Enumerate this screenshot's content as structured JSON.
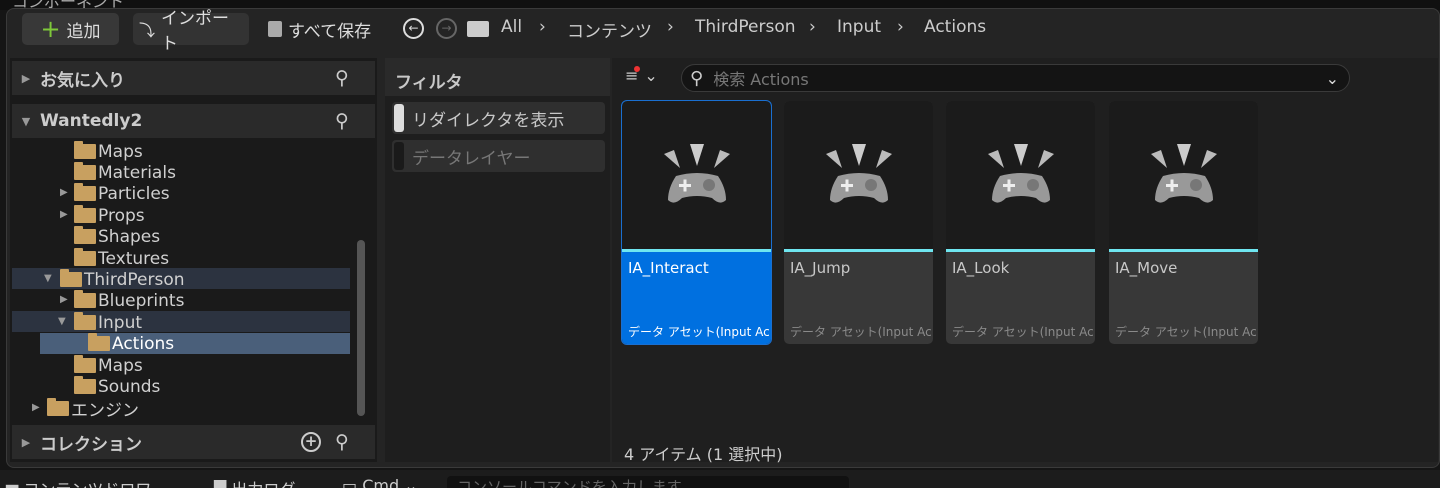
{
  "top_strip": "コンポーネント",
  "toolbar": {
    "add": "追加",
    "import": "インポート",
    "save_all": "すべて保存"
  },
  "breadcrumb": [
    "All",
    "コンテンツ",
    "ThirdPerson",
    "Input",
    "Actions"
  ],
  "sidebar": {
    "favorites": "お気に入り",
    "project": "Wantedly2",
    "tree": [
      {
        "label": "Maps"
      },
      {
        "label": "Materials"
      },
      {
        "label": "Particles"
      },
      {
        "label": "Props"
      },
      {
        "label": "Shapes"
      },
      {
        "label": "Textures"
      },
      {
        "label": "ThirdPerson"
      },
      {
        "label": "Blueprints"
      },
      {
        "label": "Input"
      },
      {
        "label": "Actions"
      },
      {
        "label": "Maps"
      },
      {
        "label": "Sounds"
      },
      {
        "label": "エンジン"
      }
    ],
    "collections": "コレクション"
  },
  "filters": {
    "title": "フィルタ",
    "items": [
      "リダイレクタを表示",
      "データレイヤー"
    ]
  },
  "search": {
    "placeholder": "検索 Actions"
  },
  "assets": [
    {
      "name": "IA_Interact",
      "type": "データ アセット(Input Ac..."
    },
    {
      "name": "IA_Jump",
      "type": "データ アセット(Input Ac..."
    },
    {
      "name": "IA_Look",
      "type": "データ アセット(Input Ac..."
    },
    {
      "name": "IA_Move",
      "type": "データ アセット(Input Ac..."
    }
  ],
  "status": "4 アイテム (1 選択中)",
  "bottom": {
    "drawer": "コンテンツドロワー",
    "output_log": "出力ログ",
    "cmd": "Cmd",
    "console_placeholder": "コンソールコマンドを入力します"
  },
  "colors": {
    "accent": "#0070e0",
    "asset_bar": "#6fe6f0",
    "folder": "#c8a060",
    "add_plus": "#7ec83a"
  }
}
